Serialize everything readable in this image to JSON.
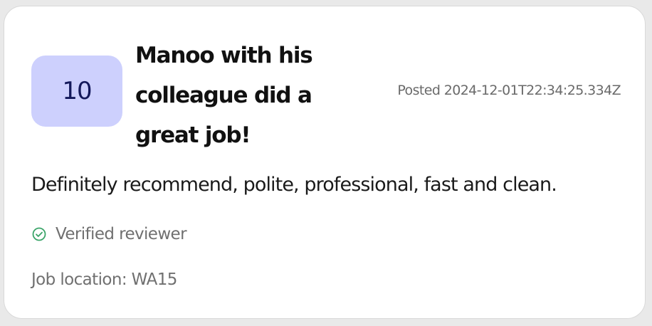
{
  "review": {
    "score": "10",
    "title": "Manoo with his colleague did a great job!",
    "posted": "Posted 2024-12-01T22:34:25.334Z",
    "body": "Definitely recommend, polite, professional, fast and clean.",
    "verified_label": "Verified reviewer",
    "verified_icon": "check-circle-icon",
    "location": "Job location: WA15"
  },
  "colors": {
    "score_bg": "#cdd0fd",
    "score_text": "#14195b",
    "verified_icon": "#3aa468",
    "muted_text": "#707070"
  }
}
